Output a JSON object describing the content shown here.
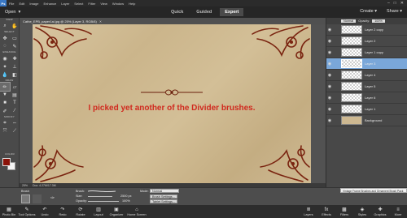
{
  "menubar": {
    "logo": "Ps",
    "items": [
      "File",
      "Edit",
      "Image",
      "Enhance",
      "Layer",
      "Select",
      "Filter",
      "View",
      "Window",
      "Help"
    ]
  },
  "modebar": {
    "open_label": "Open",
    "modes": [
      "Quick",
      "Guided",
      "Expert"
    ],
    "active_mode": "Expert",
    "create_label": "Create",
    "share_label": "Share"
  },
  "document": {
    "tab_title": "Cathe_EPB_paper1ai.jpg @ 25% (Layer 3, RGB/8)",
    "caption": "I picked yet another of the Divider brushes.",
    "zoom": "25%",
    "doc_size": "Doc: 4.27M/17.3M"
  },
  "toolbox": {
    "sections": [
      "VIEW",
      "SELECT",
      "ENHANCE",
      "DRAW",
      "MODIFY",
      "COLOR"
    ],
    "fg_color": "#8a1208",
    "bg_color": "#f4f4f4"
  },
  "layers_panel": {
    "blend_mode": "Normal",
    "opacity_label": "Opacity:",
    "opacity_value": "100%",
    "layers": [
      {
        "name": "Layer 2 copy",
        "active": false
      },
      {
        "name": "Layer 2",
        "active": false
      },
      {
        "name": "Layer 1 copy",
        "active": false
      },
      {
        "name": "Layer 3",
        "active": true
      },
      {
        "name": "Layer 4",
        "active": false
      },
      {
        "name": "Layer 5",
        "active": false
      },
      {
        "name": "Layer 6",
        "active": false
      },
      {
        "name": "Layer 1",
        "active": false
      },
      {
        "name": "Background",
        "active": false
      }
    ]
  },
  "tooltip": "Vintage Frame Brushes and Ornament Brush Pack",
  "tool_options": {
    "section_label": "Brush",
    "brush_label": "Brush:",
    "size_label": "Size:",
    "size_value": "2500 px",
    "opacity_label": "Opacity:",
    "opacity_value": "100%",
    "mode_label": "Mode:",
    "mode_value": "Normal",
    "brush_settings": "Brush Settings...",
    "tablet_settings": "Tablet Settings..."
  },
  "taskbar": {
    "left": [
      "Photo Bin",
      "Tool Options",
      "Undo",
      "Redo",
      "Rotate",
      "Layout",
      "Organizer",
      "Home Screen"
    ],
    "right": [
      "Layers",
      "Effects",
      "Filters",
      "Styles",
      "Graphics",
      "More"
    ]
  }
}
